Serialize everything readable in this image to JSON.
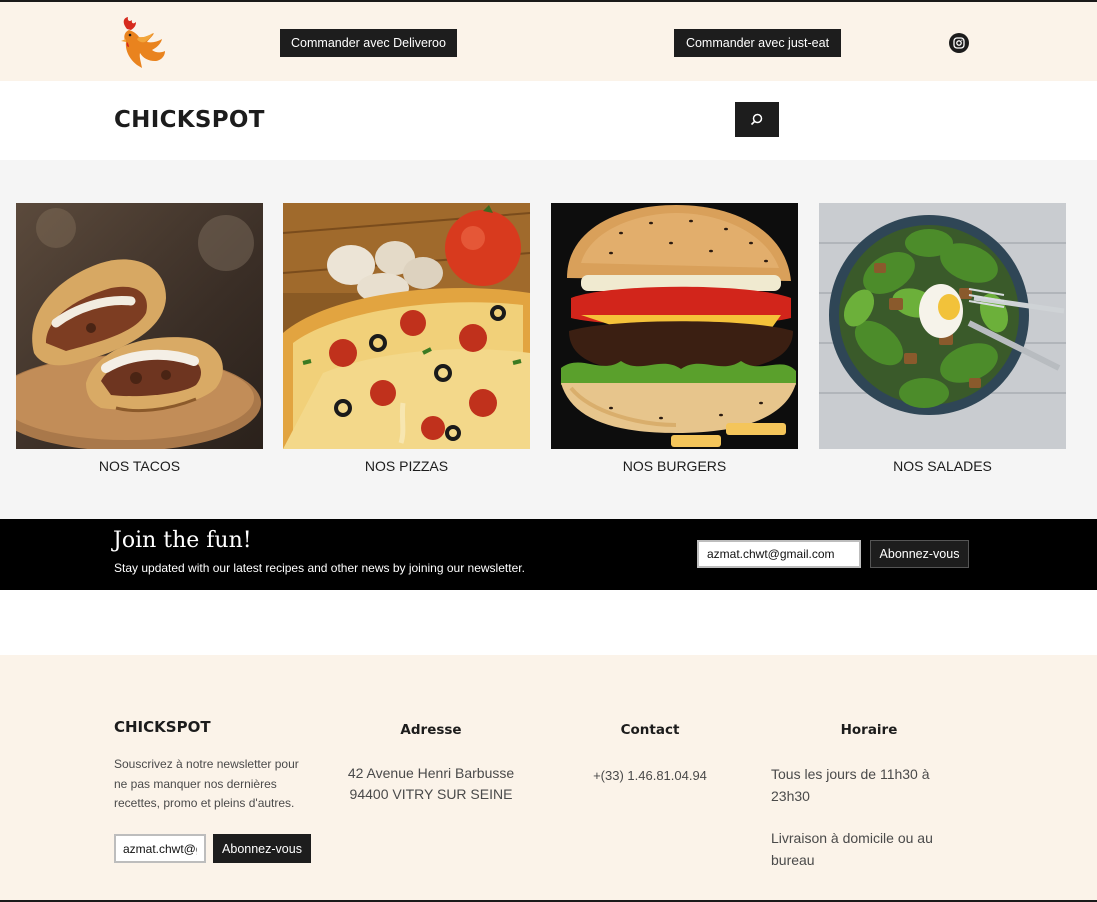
{
  "topbar": {
    "deliveroo_label": "Commander avec Deliveroo",
    "justeat_label": "Commander avec just-eat",
    "colors": {
      "background": "#fbf3e9",
      "button": "#1d1d1d"
    }
  },
  "header": {
    "brand": "CHICKSPOT"
  },
  "categories": [
    {
      "label": "NOS TACOS",
      "icon": "tacos-photo"
    },
    {
      "label": "NOS PIZZAS",
      "icon": "pizza-photo"
    },
    {
      "label": "NOS BURGERS",
      "icon": "burger-photo"
    },
    {
      "label": "NOS SALADES",
      "icon": "salad-photo"
    }
  ],
  "newsletter_band": {
    "title": "Join the fun!",
    "subtitle": "Stay updated with our latest recipes and other news by joining our newsletter.",
    "email_value": "azmat.chwt@gmail.com",
    "button_label": "Abonnez-vous"
  },
  "footer": {
    "brand": "CHICKSPOT",
    "description": "Souscrivez à notre newsletter pour ne pas manquer nos dernières recettes, promo et pleins d'autres.",
    "email_value": "azmat.chwt@gmail.com",
    "button_label": "Abonnez-vous",
    "address_title": "Adresse",
    "address_line1": "42 Avenue Henri Barbusse",
    "address_line2": "94400 VITRY SUR SEINE",
    "contact_title": "Contact",
    "phone": "+(33) 1.46.81.04.94",
    "hours_title": "Horaire",
    "hours": "Tous les jours de 11h30 à 23h30",
    "delivery": "Livraison à domicile ou au bureau"
  }
}
